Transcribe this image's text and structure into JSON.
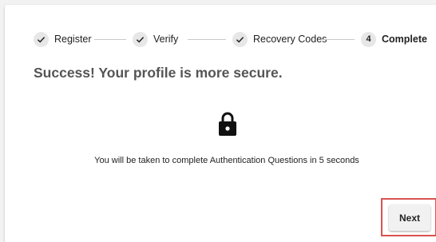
{
  "stepper": {
    "steps": [
      {
        "label": "Register",
        "state": "done"
      },
      {
        "label": "Verify",
        "state": "done"
      },
      {
        "label": "Recovery Codes",
        "state": "done"
      },
      {
        "number": "4",
        "label": "Complete",
        "state": "current"
      }
    ]
  },
  "main": {
    "title": "Success! Your profile is more secure.",
    "icon": "lock-icon",
    "message": "You will be taken to complete Authentication Questions in 5 seconds"
  },
  "footer": {
    "next_label": "Next"
  },
  "colors": {
    "highlight": "#d9534f",
    "title": "#555555",
    "step_circle": "#e7e7e7"
  }
}
